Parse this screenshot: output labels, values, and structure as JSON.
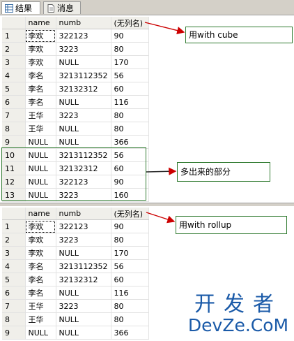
{
  "tabs": [
    {
      "label": "结果",
      "icon": "grid-icon"
    },
    {
      "label": "消息",
      "icon": "document-icon"
    }
  ],
  "columns": [
    "name",
    "numb",
    "(无列名)"
  ],
  "grid1_rows": [
    [
      "1",
      "李欢",
      "322123",
      "90"
    ],
    [
      "2",
      "李欢",
      "3223",
      "80"
    ],
    [
      "3",
      "李欢",
      "NULL",
      "170"
    ],
    [
      "4",
      "李名",
      "3213112352",
      "56"
    ],
    [
      "5",
      "李名",
      "32132312",
      "60"
    ],
    [
      "6",
      "李名",
      "NULL",
      "116"
    ],
    [
      "7",
      "王华",
      "3223",
      "80"
    ],
    [
      "8",
      "王华",
      "NULL",
      "80"
    ],
    [
      "9",
      "NULL",
      "NULL",
      "366"
    ],
    [
      "10",
      "NULL",
      "3213112352",
      "56"
    ],
    [
      "11",
      "NULL",
      "32132312",
      "60"
    ],
    [
      "12",
      "NULL",
      "322123",
      "90"
    ],
    [
      "13",
      "NULL",
      "3223",
      "160"
    ]
  ],
  "grid2_rows": [
    [
      "1",
      "李欢",
      "322123",
      "90"
    ],
    [
      "2",
      "李欢",
      "3223",
      "80"
    ],
    [
      "3",
      "李欢",
      "NULL",
      "170"
    ],
    [
      "4",
      "李名",
      "3213112352",
      "56"
    ],
    [
      "5",
      "李名",
      "32132312",
      "60"
    ],
    [
      "6",
      "李名",
      "NULL",
      "116"
    ],
    [
      "7",
      "王华",
      "3223",
      "80"
    ],
    [
      "8",
      "王华",
      "NULL",
      "80"
    ],
    [
      "9",
      "NULL",
      "NULL",
      "366"
    ]
  ],
  "annotations": {
    "cube": "用with cube",
    "extra": "多出来的部分",
    "rollup": "用with rollup"
  },
  "watermark": {
    "line1": "开发者",
    "line2": "DevZe.CoM"
  },
  "colors": {
    "arrow": "#cc0000",
    "note_border": "#2f7a2f",
    "watermark": "#1a5aa8"
  }
}
